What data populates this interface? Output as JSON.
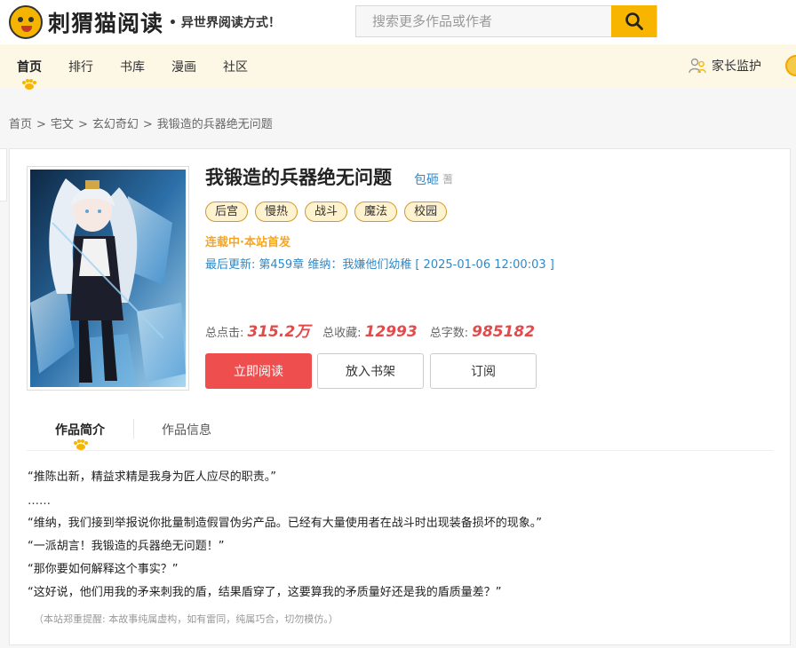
{
  "header": {
    "logo_title": "刺猬猫阅读",
    "slogan": "• 异世界阅读方式！",
    "search_placeholder": "搜索更多作品或作者"
  },
  "nav": {
    "items": [
      "首页",
      "排行",
      "书库",
      "漫画",
      "社区"
    ],
    "active": "首页",
    "parent_control": "家长监护"
  },
  "breadcrumb": [
    "首页",
    "宅文",
    "玄幻奇幻",
    "我锻造的兵器绝无问题"
  ],
  "book": {
    "title": "我锻造的兵器绝无问题",
    "author": "包砸",
    "author_badge": "蓍",
    "tags": [
      "后宫",
      "慢热",
      "战斗",
      "魔法",
      "校园"
    ],
    "status": "连载中·本站首发",
    "update_label": "最后更新:",
    "update_chapter": "第459章 维纳：我嫌他们幼稚",
    "update_time": "[ 2025-01-06 12:00:03 ]",
    "stats": {
      "clicks_label": "总点击:",
      "clicks": "315.2万",
      "favorites_label": "总收藏:",
      "favorites": "12993",
      "words_label": "总字数:",
      "words": "985182"
    }
  },
  "buttons": {
    "read": "立即阅读",
    "shelf": "放入书架",
    "subscribe": "订阅"
  },
  "tabs": [
    "作品简介",
    "作品信息"
  ],
  "intro": {
    "lines": [
      "“推陈出新，精益求精是我身为匠人应尽的职责。”",
      "……",
      "“维纳，我们接到举报说你批量制造假冒伪劣产品。已经有大量使用者在战斗时出现装备损坏的现象。”",
      "“一派胡言！我锻造的兵器绝无问题！”",
      "“那你要如何解释这个事实？”",
      "“这好说，他们用我的矛来刺我的盾，结果盾穿了，这要算我的矛质量好还是我的盾质量差？”"
    ],
    "notice": "（本站郑重提醒: 本故事纯属虚构，如有雷同，纯属巧合，切勿模仿。）"
  },
  "colors": {
    "accent": "#f7b500",
    "read_button": "#ee4e4e",
    "link": "#2f89c8",
    "stat_value": "#e34b4b",
    "nav_bg": "#fdf7e6"
  }
}
